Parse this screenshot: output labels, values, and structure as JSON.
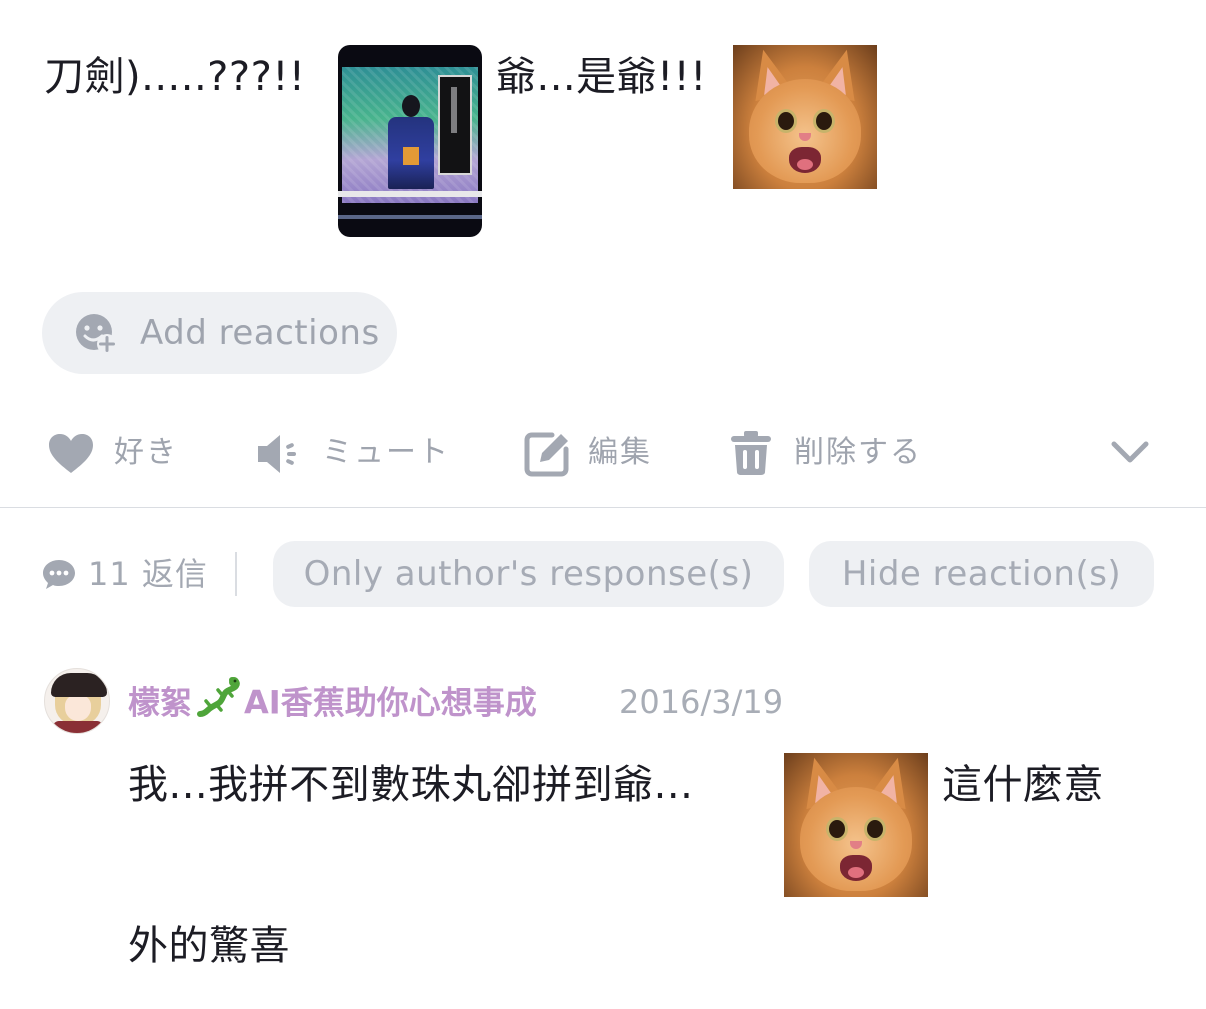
{
  "post": {
    "text_part1": "刀劍).....???!!",
    "text_part2": "爺...是爺!!!"
  },
  "reactions": {
    "add_label": "Add reactions"
  },
  "actions": {
    "like": "好き",
    "mute": "ミュート",
    "edit": "編集",
    "delete": "削除する"
  },
  "replies": {
    "count_label": "11 返信",
    "filter_author": "Only author's response(s)",
    "filter_hide": "Hide reaction(s)"
  },
  "comment": {
    "username_part1": "檬絮",
    "username_part2": "AI香蕉助你心想事成",
    "timestamp": "2016/3/19",
    "text_part1": "我...我拼不到數珠丸卻拼到爺...",
    "text_part2": "這什麼意",
    "text_part3": "外的驚喜"
  },
  "colors": {
    "text": "#1c1c24",
    "muted": "#9fa4ae",
    "pill_bg": "#eef0f3",
    "username": "#bf93cb",
    "divider": "#dadde2"
  },
  "icons": {
    "add_reaction": "smiley-plus-icon",
    "like": "heart-icon",
    "mute": "speaker-mute-icon",
    "edit": "edit-icon",
    "delete": "trash-icon",
    "more": "chevron-down-icon",
    "replies": "chat-bubble-icon"
  }
}
